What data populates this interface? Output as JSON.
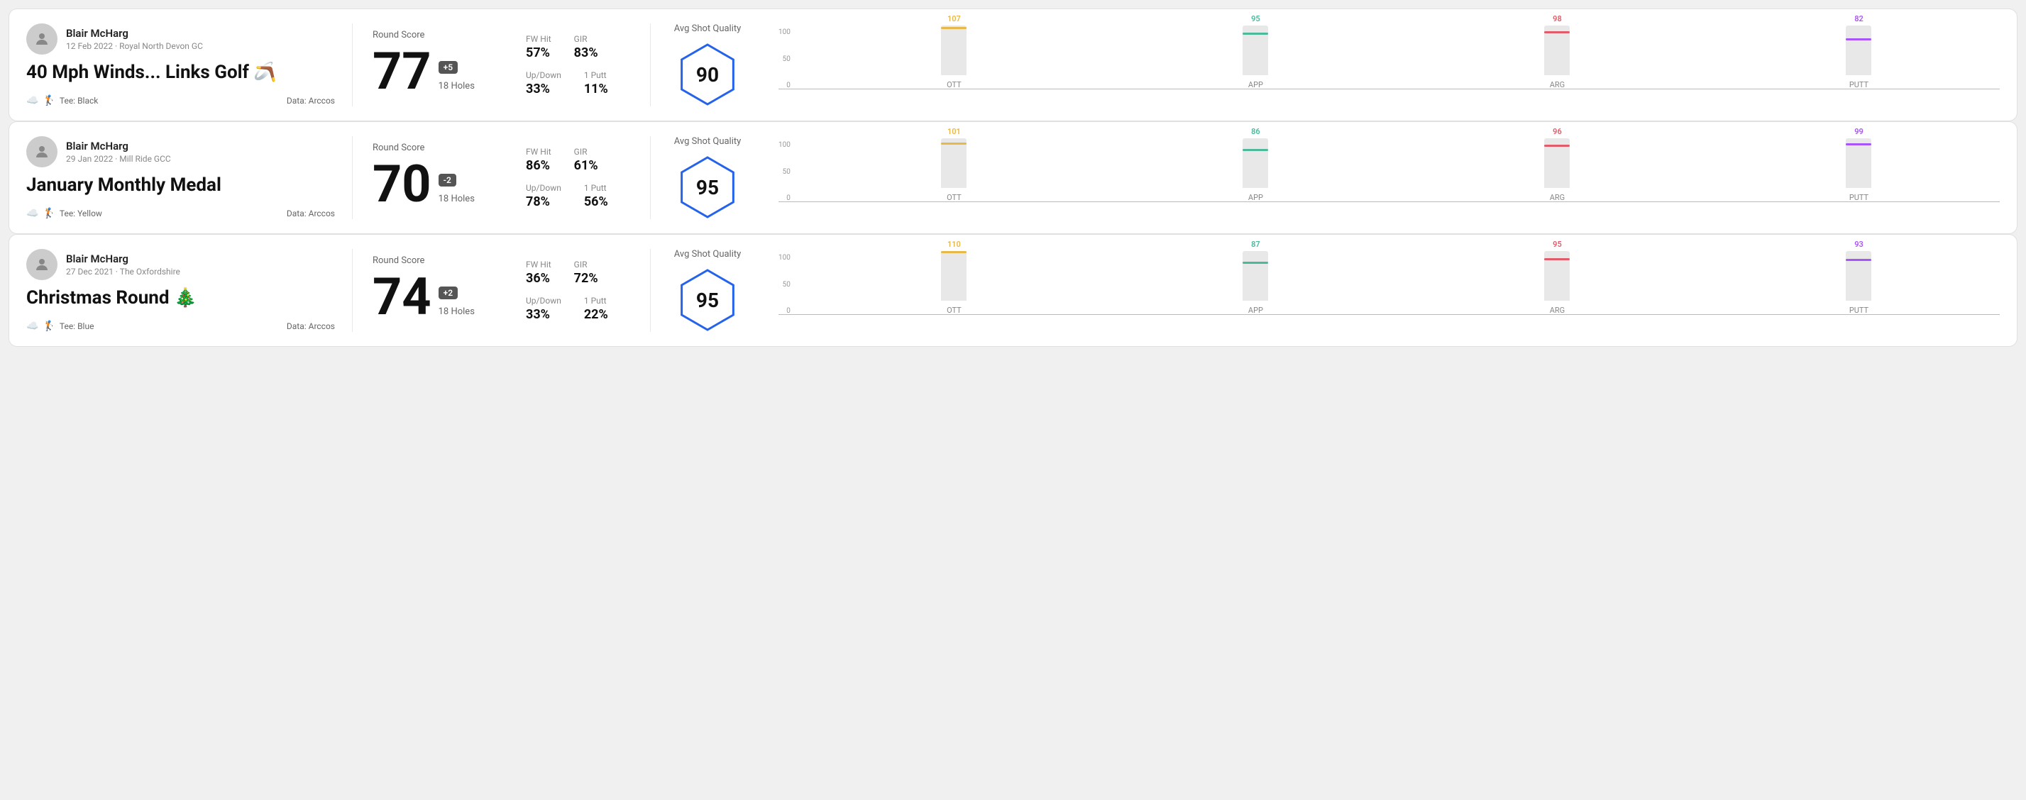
{
  "rounds": [
    {
      "id": "round1",
      "user": {
        "name": "Blair McHarg",
        "date": "12 Feb 2022 · Royal North Devon GC"
      },
      "title": "40 Mph Winds... Links Golf 🪃",
      "tee": "Black",
      "data_source": "Data: Arccos",
      "round_score_label": "Round Score",
      "score": "77",
      "score_diff": "+5",
      "holes": "18 Holes",
      "fw_hit_label": "FW Hit",
      "fw_hit": "57%",
      "gir_label": "GIR",
      "gir": "83%",
      "updown_label": "Up/Down",
      "updown": "33%",
      "oneputt_label": "1 Putt",
      "oneputt": "11%",
      "avg_quality_label": "Avg Shot Quality",
      "quality_score": "90",
      "bars": [
        {
          "label": "OTT",
          "value": 107,
          "color": "#e8b84b",
          "max": 110
        },
        {
          "label": "APP",
          "value": 95,
          "color": "#4db89a",
          "max": 110
        },
        {
          "label": "ARG",
          "value": 98,
          "color": "#e05c6a",
          "max": 110
        },
        {
          "label": "PUTT",
          "value": 82,
          "color": "#a855f7",
          "max": 110
        }
      ]
    },
    {
      "id": "round2",
      "user": {
        "name": "Blair McHarg",
        "date": "29 Jan 2022 · Mill Ride GCC"
      },
      "title": "January Monthly Medal",
      "tee": "Yellow",
      "data_source": "Data: Arccos",
      "round_score_label": "Round Score",
      "score": "70",
      "score_diff": "-2",
      "holes": "18 Holes",
      "fw_hit_label": "FW Hit",
      "fw_hit": "86%",
      "gir_label": "GIR",
      "gir": "61%",
      "updown_label": "Up/Down",
      "updown": "78%",
      "oneputt_label": "1 Putt",
      "oneputt": "56%",
      "avg_quality_label": "Avg Shot Quality",
      "quality_score": "95",
      "bars": [
        {
          "label": "OTT",
          "value": 101,
          "color": "#e8b84b",
          "max": 110
        },
        {
          "label": "APP",
          "value": 86,
          "color": "#4db89a",
          "max": 110
        },
        {
          "label": "ARG",
          "value": 96,
          "color": "#e05c6a",
          "max": 110
        },
        {
          "label": "PUTT",
          "value": 99,
          "color": "#a855f7",
          "max": 110
        }
      ]
    },
    {
      "id": "round3",
      "user": {
        "name": "Blair McHarg",
        "date": "27 Dec 2021 · The Oxfordshire"
      },
      "title": "Christmas Round 🎄",
      "tee": "Blue",
      "data_source": "Data: Arccos",
      "round_score_label": "Round Score",
      "score": "74",
      "score_diff": "+2",
      "holes": "18 Holes",
      "fw_hit_label": "FW Hit",
      "fw_hit": "36%",
      "gir_label": "GIR",
      "gir": "72%",
      "updown_label": "Up/Down",
      "updown": "33%",
      "oneputt_label": "1 Putt",
      "oneputt": "22%",
      "avg_quality_label": "Avg Shot Quality",
      "quality_score": "95",
      "bars": [
        {
          "label": "OTT",
          "value": 110,
          "color": "#e8b84b",
          "max": 110
        },
        {
          "label": "APP",
          "value": 87,
          "color": "#4db89a",
          "max": 110
        },
        {
          "label": "ARG",
          "value": 95,
          "color": "#e05c6a",
          "max": 110
        },
        {
          "label": "PUTT",
          "value": 93,
          "color": "#a855f7",
          "max": 110
        }
      ]
    }
  ],
  "y_labels": [
    "100",
    "50",
    "0"
  ]
}
